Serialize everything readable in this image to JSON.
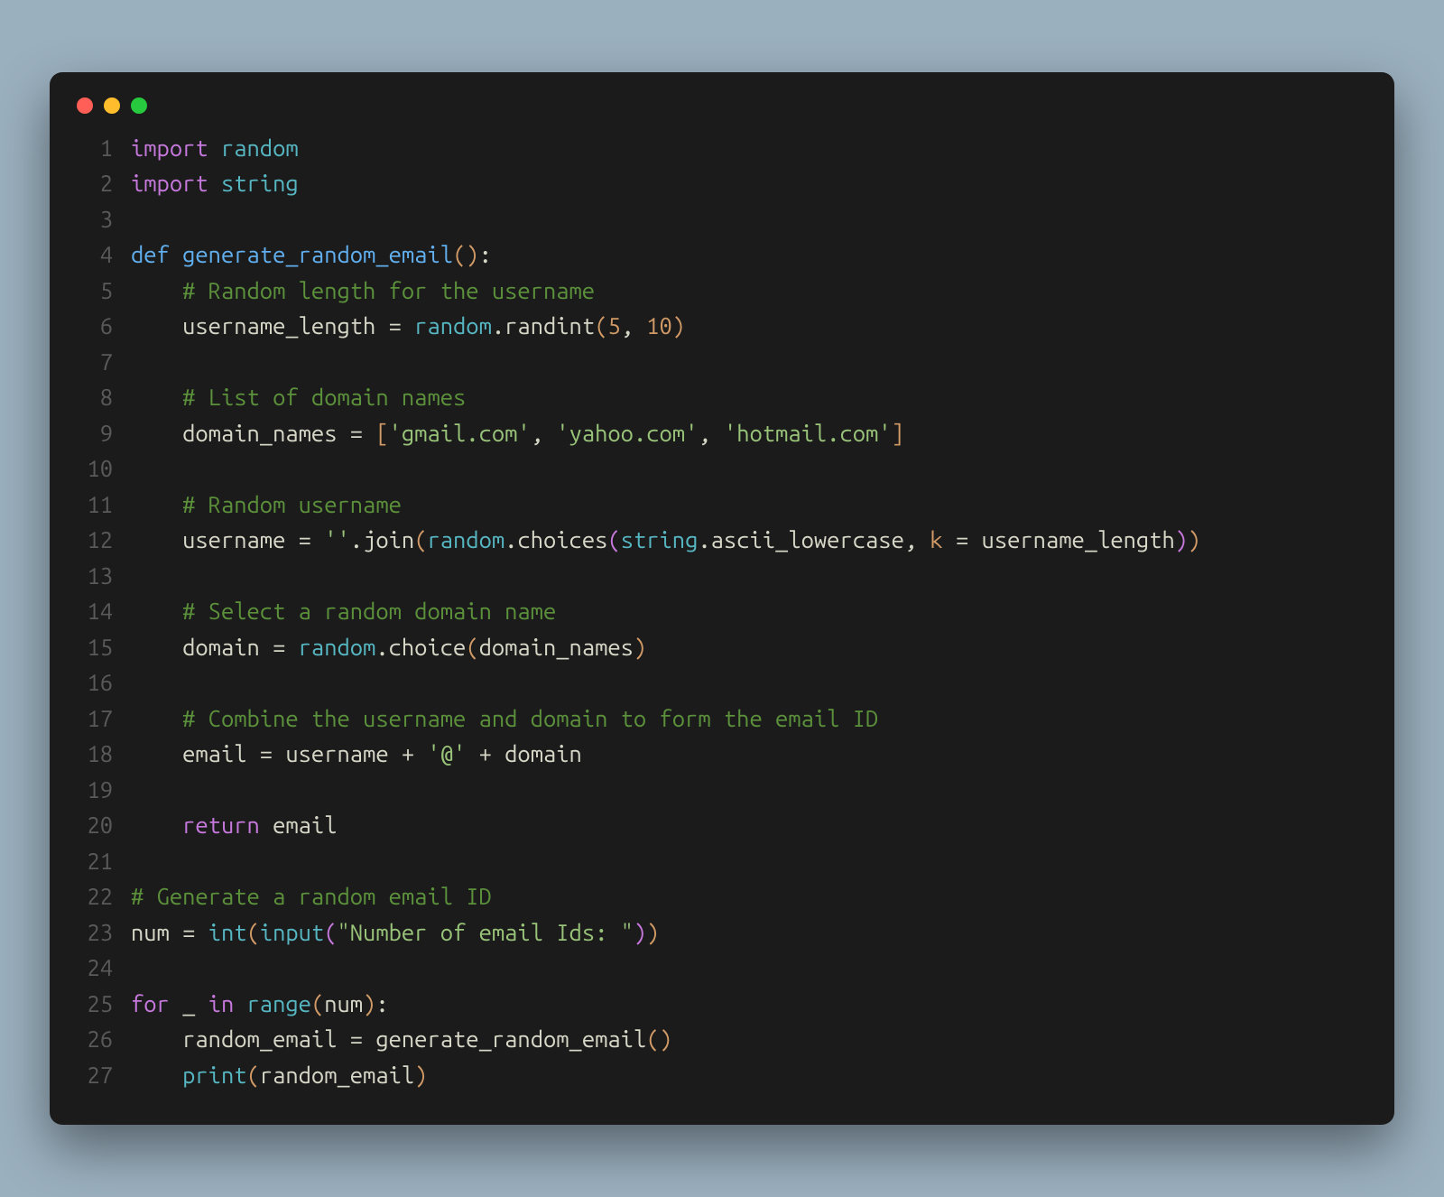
{
  "code": {
    "lines": [
      {
        "n": "1",
        "tokens": [
          {
            "t": "import",
            "c": "kw-import"
          },
          {
            "t": " ",
            "c": ""
          },
          {
            "t": "random",
            "c": "module"
          }
        ]
      },
      {
        "n": "2",
        "tokens": [
          {
            "t": "import",
            "c": "kw-import"
          },
          {
            "t": " ",
            "c": ""
          },
          {
            "t": "string",
            "c": "module"
          }
        ]
      },
      {
        "n": "3",
        "tokens": []
      },
      {
        "n": "4",
        "tokens": [
          {
            "t": "def",
            "c": "kw-def"
          },
          {
            "t": " ",
            "c": ""
          },
          {
            "t": "generate_random_email",
            "c": "func-name"
          },
          {
            "t": "(",
            "c": "paren"
          },
          {
            "t": ")",
            "c": "paren"
          },
          {
            "t": ":",
            "c": "var"
          }
        ]
      },
      {
        "n": "5",
        "tokens": [
          {
            "t": "    ",
            "c": ""
          },
          {
            "t": "# Random length for the username",
            "c": "comment"
          }
        ]
      },
      {
        "n": "6",
        "tokens": [
          {
            "t": "    ",
            "c": ""
          },
          {
            "t": "username_length",
            "c": "var"
          },
          {
            "t": " = ",
            "c": "op"
          },
          {
            "t": "random",
            "c": "obj"
          },
          {
            "t": ".",
            "c": "var"
          },
          {
            "t": "randint",
            "c": "func-method"
          },
          {
            "t": "(",
            "c": "paren"
          },
          {
            "t": "5",
            "c": "num"
          },
          {
            "t": ", ",
            "c": "var"
          },
          {
            "t": "10",
            "c": "num"
          },
          {
            "t": ")",
            "c": "paren"
          }
        ]
      },
      {
        "n": "7",
        "tokens": []
      },
      {
        "n": "8",
        "tokens": [
          {
            "t": "    ",
            "c": ""
          },
          {
            "t": "# List of domain names",
            "c": "comment"
          }
        ]
      },
      {
        "n": "9",
        "tokens": [
          {
            "t": "    ",
            "c": ""
          },
          {
            "t": "domain_names",
            "c": "var"
          },
          {
            "t": " = ",
            "c": "op"
          },
          {
            "t": "[",
            "c": "bracket"
          },
          {
            "t": "'gmail.com'",
            "c": "str"
          },
          {
            "t": ", ",
            "c": "var"
          },
          {
            "t": "'yahoo.com'",
            "c": "str"
          },
          {
            "t": ", ",
            "c": "var"
          },
          {
            "t": "'hotmail.com'",
            "c": "str"
          },
          {
            "t": "]",
            "c": "bracket"
          }
        ]
      },
      {
        "n": "10",
        "tokens": []
      },
      {
        "n": "11",
        "tokens": [
          {
            "t": "    ",
            "c": ""
          },
          {
            "t": "# Random username",
            "c": "comment"
          }
        ]
      },
      {
        "n": "12",
        "tokens": [
          {
            "t": "    ",
            "c": ""
          },
          {
            "t": "username",
            "c": "var"
          },
          {
            "t": " = ",
            "c": "op"
          },
          {
            "t": "''",
            "c": "str"
          },
          {
            "t": ".",
            "c": "var"
          },
          {
            "t": "join",
            "c": "func-method"
          },
          {
            "t": "(",
            "c": "paren"
          },
          {
            "t": "random",
            "c": "obj"
          },
          {
            "t": ".",
            "c": "var"
          },
          {
            "t": "choices",
            "c": "func-method"
          },
          {
            "t": "(",
            "c": "paren2"
          },
          {
            "t": "string",
            "c": "obj"
          },
          {
            "t": ".",
            "c": "var"
          },
          {
            "t": "ascii_lowercase",
            "c": "var"
          },
          {
            "t": ", ",
            "c": "var"
          },
          {
            "t": "k",
            "c": "arg"
          },
          {
            "t": " = ",
            "c": "op"
          },
          {
            "t": "username_length",
            "c": "var"
          },
          {
            "t": ")",
            "c": "paren2"
          },
          {
            "t": ")",
            "c": "paren"
          }
        ]
      },
      {
        "n": "13",
        "tokens": []
      },
      {
        "n": "14",
        "tokens": [
          {
            "t": "    ",
            "c": ""
          },
          {
            "t": "# Select a random domain name",
            "c": "comment"
          }
        ]
      },
      {
        "n": "15",
        "tokens": [
          {
            "t": "    ",
            "c": ""
          },
          {
            "t": "domain",
            "c": "var"
          },
          {
            "t": " = ",
            "c": "op"
          },
          {
            "t": "random",
            "c": "obj"
          },
          {
            "t": ".",
            "c": "var"
          },
          {
            "t": "choice",
            "c": "func-method"
          },
          {
            "t": "(",
            "c": "paren"
          },
          {
            "t": "domain_names",
            "c": "var"
          },
          {
            "t": ")",
            "c": "paren"
          }
        ]
      },
      {
        "n": "16",
        "tokens": []
      },
      {
        "n": "17",
        "tokens": [
          {
            "t": "    ",
            "c": ""
          },
          {
            "t": "# Combine the username and domain to form the email ID",
            "c": "comment"
          }
        ]
      },
      {
        "n": "18",
        "tokens": [
          {
            "t": "    ",
            "c": ""
          },
          {
            "t": "email",
            "c": "var"
          },
          {
            "t": " = ",
            "c": "op"
          },
          {
            "t": "username",
            "c": "var"
          },
          {
            "t": " + ",
            "c": "op"
          },
          {
            "t": "'@'",
            "c": "str"
          },
          {
            "t": " + ",
            "c": "op"
          },
          {
            "t": "domain",
            "c": "var"
          }
        ]
      },
      {
        "n": "19",
        "tokens": []
      },
      {
        "n": "20",
        "tokens": [
          {
            "t": "    ",
            "c": ""
          },
          {
            "t": "return",
            "c": "kw-return"
          },
          {
            "t": " ",
            "c": ""
          },
          {
            "t": "email",
            "c": "var"
          }
        ]
      },
      {
        "n": "21",
        "tokens": []
      },
      {
        "n": "22",
        "tokens": [
          {
            "t": "# Generate a random email ID",
            "c": "comment"
          }
        ]
      },
      {
        "n": "23",
        "tokens": [
          {
            "t": "num",
            "c": "var"
          },
          {
            "t": " = ",
            "c": "op"
          },
          {
            "t": "int",
            "c": "builtin"
          },
          {
            "t": "(",
            "c": "paren"
          },
          {
            "t": "input",
            "c": "builtin"
          },
          {
            "t": "(",
            "c": "paren2"
          },
          {
            "t": "\"Number of email Ids: \"",
            "c": "str"
          },
          {
            "t": ")",
            "c": "paren2"
          },
          {
            "t": ")",
            "c": "paren"
          }
        ]
      },
      {
        "n": "24",
        "tokens": []
      },
      {
        "n": "25",
        "tokens": [
          {
            "t": "for",
            "c": "kw-for"
          },
          {
            "t": " ",
            "c": ""
          },
          {
            "t": "_",
            "c": "var"
          },
          {
            "t": " ",
            "c": ""
          },
          {
            "t": "in",
            "c": "kw-in"
          },
          {
            "t": " ",
            "c": ""
          },
          {
            "t": "range",
            "c": "builtin"
          },
          {
            "t": "(",
            "c": "paren"
          },
          {
            "t": "num",
            "c": "var"
          },
          {
            "t": ")",
            "c": "paren"
          },
          {
            "t": ":",
            "c": "var"
          }
        ]
      },
      {
        "n": "26",
        "tokens": [
          {
            "t": "    ",
            "c": ""
          },
          {
            "t": "random_email",
            "c": "var"
          },
          {
            "t": " = ",
            "c": "op"
          },
          {
            "t": "generate_random_email",
            "c": "func-method"
          },
          {
            "t": "(",
            "c": "paren"
          },
          {
            "t": ")",
            "c": "paren"
          }
        ]
      },
      {
        "n": "27",
        "tokens": [
          {
            "t": "    ",
            "c": ""
          },
          {
            "t": "print",
            "c": "builtin"
          },
          {
            "t": "(",
            "c": "paren"
          },
          {
            "t": "random_email",
            "c": "var"
          },
          {
            "t": ")",
            "c": "paren"
          }
        ]
      }
    ]
  }
}
